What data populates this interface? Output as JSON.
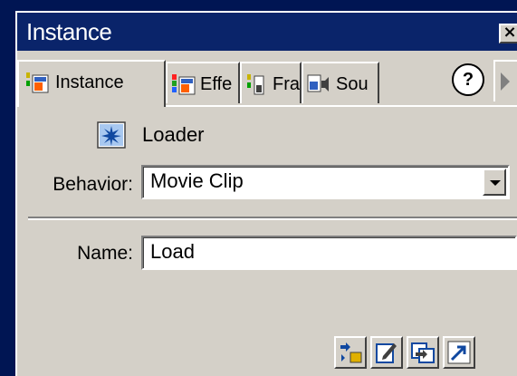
{
  "window": {
    "title": "Instance",
    "close_glyph": "×"
  },
  "tabs": [
    {
      "label": "Instance",
      "icon": "instance-icon",
      "active": true
    },
    {
      "label": "Effe",
      "icon": "effect-icon",
      "active": false
    },
    {
      "label": "Fra",
      "icon": "frame-icon",
      "active": false
    },
    {
      "label": "Sou",
      "icon": "sound-icon",
      "active": false
    }
  ],
  "help_label": "?",
  "symbol": {
    "icon": "movie-clip-symbol-icon",
    "name": "Loader"
  },
  "behavior": {
    "label": "Behavior:",
    "value": "Movie Clip"
  },
  "name_field": {
    "label": "Name:",
    "value": "Load"
  },
  "toolbar": [
    {
      "icon": "swap-symbol-icon"
    },
    {
      "icon": "edit-symbol-icon"
    },
    {
      "icon": "duplicate-symbol-icon"
    },
    {
      "icon": "edit-actions-icon"
    }
  ],
  "colors": {
    "titlebar": "#0a246a",
    "panel": "#d4d0c8",
    "background": "#001553"
  }
}
